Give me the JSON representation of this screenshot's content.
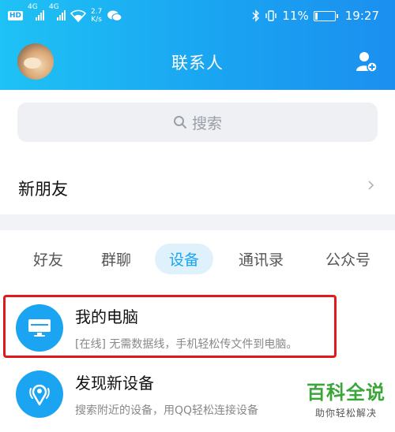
{
  "status_bar": {
    "hd": "HD",
    "net1": "4G",
    "net2": "4G",
    "speed_value": "2.7",
    "speed_unit": "K/s",
    "battery_percent": "11%",
    "battery_level": 0.11,
    "time": "19:27"
  },
  "header": {
    "title": "联系人"
  },
  "search": {
    "placeholder": "搜索"
  },
  "new_friends": {
    "label": "新朋友"
  },
  "tabs": [
    {
      "label": "好友"
    },
    {
      "label": "群聊"
    },
    {
      "label": "设备",
      "active": true
    },
    {
      "label": "通讯录"
    },
    {
      "label": "公众号"
    }
  ],
  "devices": [
    {
      "name": "我的电脑",
      "desc": "[在线] 无需数据线，手机轻松传文件到电脑。"
    },
    {
      "name": "发现新设备",
      "desc": "搜索附近的设备，用QQ轻松连接设备"
    }
  ],
  "watermark": {
    "big": "百科全说",
    "small": "助你轻松解决"
  },
  "colors": {
    "accent": "#1aa4f1",
    "highlight": "#e01a1a",
    "watermark": "#3aa538"
  },
  "icons": [
    "wifi-icon",
    "wechat-icon",
    "bluetooth-icon",
    "vibrate-icon",
    "battery-icon",
    "add-contact-icon",
    "search-icon",
    "chevron-right-icon",
    "computer-icon",
    "radar-icon"
  ]
}
